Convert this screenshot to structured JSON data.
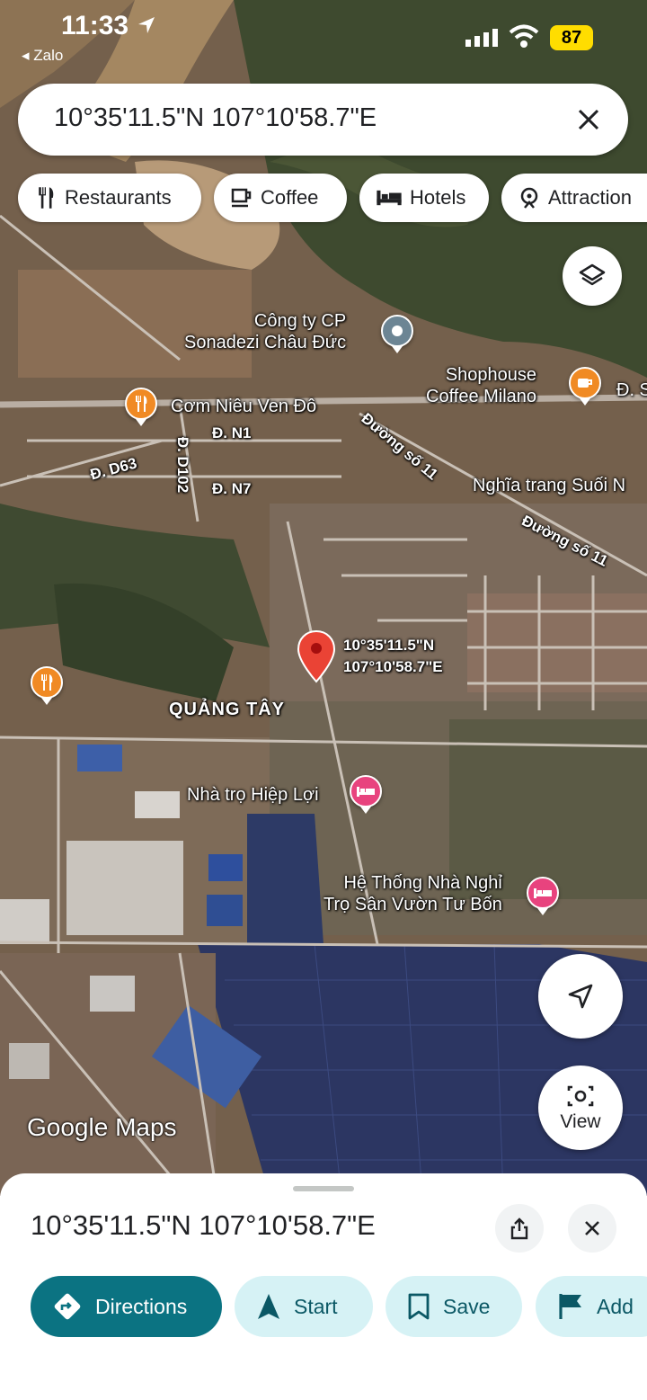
{
  "status_bar": {
    "time": "11:33",
    "back_app": "◂ Zalo",
    "battery": "87"
  },
  "search": {
    "value": "10°35'11.5\"N 107°10'58.7\"E"
  },
  "chips": [
    {
      "label": "Restaurants",
      "icon": "fork-knife-icon"
    },
    {
      "label": "Coffee",
      "icon": "coffee-cup-icon"
    },
    {
      "label": "Hotels",
      "icon": "bed-icon"
    },
    {
      "label": "Attraction",
      "icon": "attraction-icon"
    }
  ],
  "map": {
    "places": {
      "company": "Công ty CP\nSonadezi Châu Đức",
      "shophouse": "Shophouse\nCoffee Milano",
      "shophouse_cut": "Đ. S",
      "restaurant": "Cơm Niêu Ven Đô",
      "cemetery": "Nghĩa trang Suối N",
      "district": "QUẢNG TÂY",
      "inn1": "Nhà trọ Hiệp Lợi",
      "inn2": "Hệ Thống Nhà Nghỉ\nTrọ Sân Vườn Tư Bốn",
      "pin_label": "10°35'11.5\"N\n107°10'58.7\"E"
    },
    "roads": {
      "n1": "Đ. N1",
      "n7": "Đ. N7",
      "d63": "Đ. D63",
      "d102": "Đ. D102",
      "so11a": "Đường số 11",
      "so11b": "Đường số 11"
    },
    "logo": "Google Maps",
    "view_label": "View"
  },
  "sheet": {
    "title": "10°35'11.5\"N 107°10'58.7\"E",
    "actions": [
      {
        "label": "Directions",
        "icon": "directions-icon"
      },
      {
        "label": "Start",
        "icon": "navigation-arrow-icon"
      },
      {
        "label": "Save",
        "icon": "bookmark-icon"
      },
      {
        "label": "Add",
        "icon": "flag-icon"
      }
    ]
  },
  "colors": {
    "primary": "#0b7382",
    "action_bg": "#d6f2f5",
    "pin": "#ea4335",
    "poi_food": "#f08a24",
    "poi_hotel": "#e8437e"
  }
}
